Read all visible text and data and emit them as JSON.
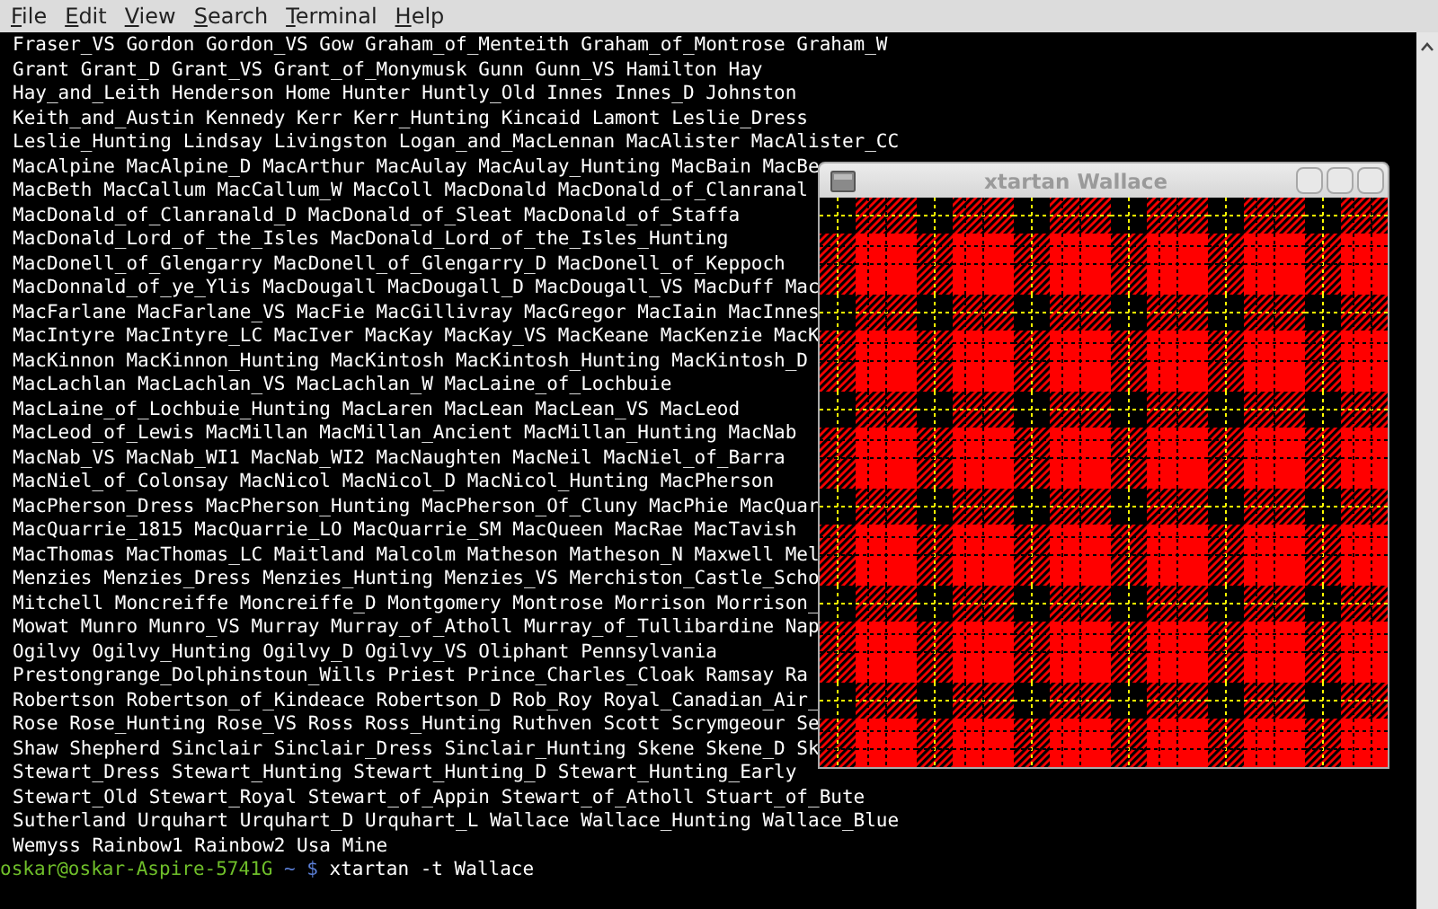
{
  "menu": [
    "File",
    "Edit",
    "View",
    "Search",
    "Terminal",
    "Help"
  ],
  "terminal": {
    "lines": [
      "Fraser_VS Gordon Gordon_VS Gow Graham_of_Menteith Graham_of_Montrose Graham_W",
      "Grant Grant_D Grant_VS Grant_of_Monymusk Gunn Gunn_VS Hamilton Hay",
      "Hay_and_Leith Henderson Home Hunter Huntly_Old Innes Innes_D Johnston",
      "Keith_and_Austin Kennedy Kerr Kerr_Hunting Kincaid Lamont Leslie_Dress",
      "Leslie_Hunting Lindsay Livingston Logan_and_MacLennan MacAlister MacAlister_CC",
      "MacAlpine MacAlpine_D MacArthur MacAulay MacAulay_Hunting MacBain MacBe",
      "MacBeth MacCallum MacCallum_W MacColl MacDonald MacDonald_of_Clanranal",
      "MacDonald_of_Clanranald_D MacDonald_of_Sleat MacDonald_of_Staffa",
      "MacDonald_Lord_of_the_Isles MacDonald_Lord_of_the_Isles_Hunting",
      "MacDonell_of_Glengarry MacDonell_of_Glengarry_D MacDonell_of_Keppoch",
      "MacDonnald_of_ye_Ylis MacDougall MacDougall_D MacDougall_VS MacDuff Mac",
      "MacFarlane MacFarlane_VS MacFie MacGillivray MacGregor MacIain MacInnes",
      "MacIntyre MacIntyre_LC MacIver MacKay MacKay_VS MacKeane MacKenzie MacK",
      "MacKinnon MacKinnon_Hunting MacKintosh MacKintosh_Hunting MacKintosh_D",
      "MacLachlan MacLachlan_VS MacLachlan_W MacLaine_of_Lochbuie",
      "MacLaine_of_Lochbuie_Hunting MacLaren MacLean MacLean_VS MacLeod",
      "MacLeod_of_Lewis MacMillan MacMillan_Ancient MacMillan_Hunting MacNab",
      "MacNab_VS MacNab_WI1 MacNab_WI2 MacNaughten MacNeil MacNiel_of_Barra",
      "MacNiel_of_Colonsay MacNicol MacNicol_D MacNicol_Hunting MacPherson",
      "MacPherson_Dress MacPherson_Hunting MacPherson_Of_Cluny MacPhie MacQuar",
      "MacQuarrie_1815 MacQuarrie_LO MacQuarrie_SM MacQueen MacRae MacTavish",
      "MacThomas MacThomas_LC Maitland Malcolm Matheson Matheson_N Maxwell Mel",
      "Menzies Menzies_Dress Menzies_Hunting Menzies_VS Merchiston_Castle_Scho",
      "Mitchell Moncreiffe Moncreiffe_D Montgomery Montrose Morrison Morrison_",
      "Mowat Munro Munro_VS Murray Murray_of_Atholl Murray_of_Tullibardine Nap",
      "Ogilvy Ogilvy_Hunting Ogilvy_D Ogilvy_VS Oliphant Pennsylvania",
      "Prestongrange_Dolphinstoun_Wills Priest Prince_Charles_Cloak Ramsay Ra",
      "Robertson Robertson_of_Kindeace Robertson_D Rob_Roy Royal_Canadian_Air_",
      "Rose Rose_Hunting Rose_VS Ross Ross_Hunting Ruthven Scott Scrymgeour Se",
      "Shaw Shepherd Sinclair Sinclair_Dress Sinclair_Hunting Skene Skene_D Sk",
      "Stewart_Dress Stewart_Hunting Stewart_Hunting_D Stewart_Hunting_Early",
      "Stewart_Old Stewart_Royal Stewart_of_Appin Stewart_of_Atholl Stuart_of_Bute",
      "Sutherland Urquhart Urquhart_D Urquhart_L Wallace Wallace_Hunting Wallace_Blue",
      "Wemyss Rainbow1 Rainbow2 Usa Mine"
    ],
    "prompt": {
      "user_host": "oskar@oskar-Aspire-5741G",
      "cwd": "~",
      "symbol": "$",
      "command": "xtartan -t Wallace"
    }
  },
  "xtartan_window": {
    "title": "xtartan Wallace"
  }
}
